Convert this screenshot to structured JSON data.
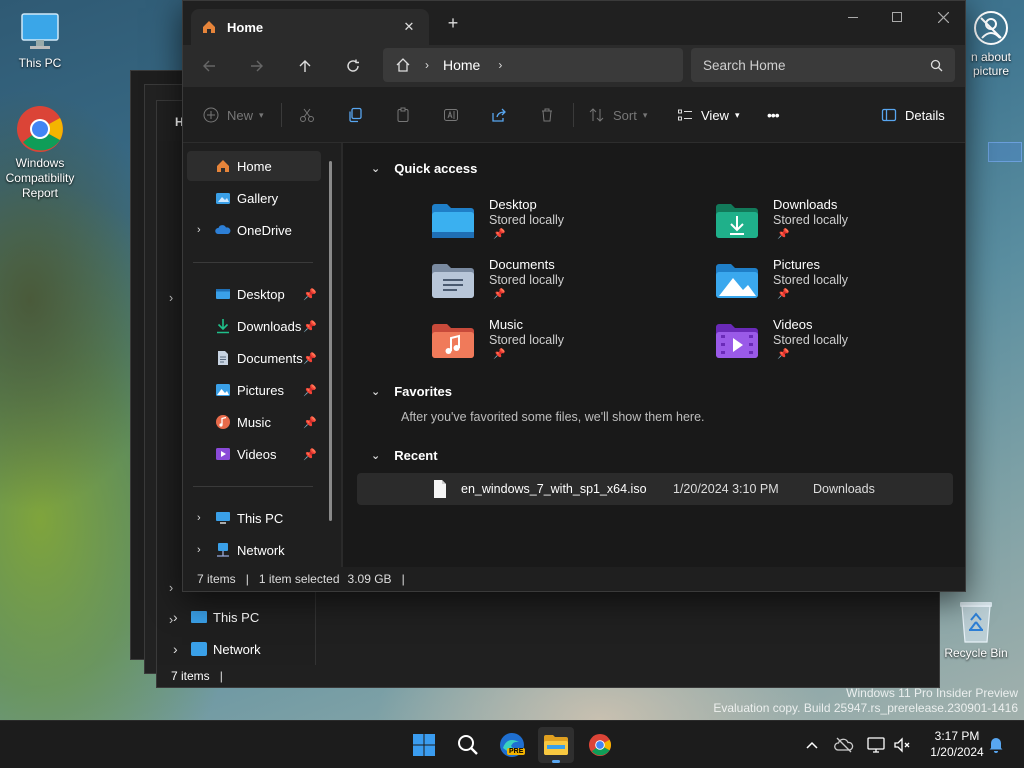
{
  "desktop": {
    "icons": [
      {
        "label": "This PC"
      },
      {
        "label": "Windows Compatibility Report"
      },
      {
        "label": "Recycle Bin"
      }
    ],
    "partial_label": "n about picture",
    "watermark_line1": "Windows 11 Pro Insider Preview",
    "watermark_line2": "Evaluation copy. Build 25947.rs_prerelease.230901-1416"
  },
  "back_window": {
    "tab_title": "Ho",
    "nav_items": [
      "This PC",
      "Network"
    ],
    "status": "7 items"
  },
  "window": {
    "tab_title": "Home",
    "tab_close": "✕",
    "new_tab": "+",
    "breadcrumb": [
      "Home"
    ],
    "search_placeholder": "Search Home",
    "toolbar": {
      "new_label": "New",
      "sort_label": "Sort",
      "view_label": "View",
      "more_label": "•••",
      "details_label": "Details"
    },
    "nav": {
      "items": [
        {
          "label": "Home"
        },
        {
          "label": "Gallery"
        },
        {
          "label": "OneDrive"
        },
        {
          "label": "Desktop"
        },
        {
          "label": "Downloads"
        },
        {
          "label": "Documents"
        },
        {
          "label": "Pictures"
        },
        {
          "label": "Music"
        },
        {
          "label": "Videos"
        },
        {
          "label": "This PC"
        },
        {
          "label": "Network"
        }
      ]
    },
    "sections": {
      "quick_access": "Quick access",
      "favorites": "Favorites",
      "favorites_empty": "After you've favorited some files, we'll show them here.",
      "recent": "Recent"
    },
    "quick_access": [
      {
        "name": "Desktop",
        "sub": "Stored locally"
      },
      {
        "name": "Downloads",
        "sub": "Stored locally"
      },
      {
        "name": "Documents",
        "sub": "Stored locally"
      },
      {
        "name": "Pictures",
        "sub": "Stored locally"
      },
      {
        "name": "Music",
        "sub": "Stored locally"
      },
      {
        "name": "Videos",
        "sub": "Stored locally"
      }
    ],
    "recent": [
      {
        "name": "en_windows_7_with_sp1_x64.iso",
        "date": "1/20/2024 3:10 PM",
        "location": "Downloads"
      }
    ],
    "status": {
      "items": "7 items",
      "selected": "1 item selected",
      "size": "3.09 GB"
    }
  },
  "taskbar": {
    "pre_badge": "PRE",
    "time": "3:17 PM",
    "date": "1/20/2024"
  },
  "colors": {
    "accent_blue": "#2d7fd6",
    "folder_desktop": "#3aa0e8",
    "folder_downloads": "#1fa37a",
    "folder_music": "#e86a4a",
    "folder_videos": "#8a4ad8",
    "home_orange": "#e6843a"
  }
}
